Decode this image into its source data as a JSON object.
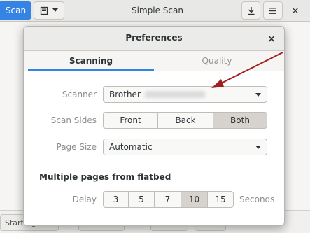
{
  "main": {
    "scan_label": "Scan",
    "title": "Simple Scan",
    "start_again_label": "Start Again..."
  },
  "dialog": {
    "title": "Preferences",
    "close_glyph": "×",
    "tabs": [
      {
        "label": "Scanning",
        "active": true
      },
      {
        "label": "Quality",
        "active": false
      }
    ],
    "scanner": {
      "label": "Scanner",
      "value": "Brother"
    },
    "scan_sides": {
      "label": "Scan Sides",
      "options": [
        "Front",
        "Back",
        "Both"
      ],
      "selected": "Both"
    },
    "page_size": {
      "label": "Page Size",
      "value": "Automatic"
    },
    "multipage": {
      "title": "Multiple pages from flatbed",
      "delay_label": "Delay",
      "delays": [
        "3",
        "5",
        "7",
        "10",
        "15"
      ],
      "selected": "10",
      "unit": "Seconds"
    }
  },
  "colors": {
    "accent": "#3584e4",
    "annotation_arrow": "#a11f1f"
  }
}
